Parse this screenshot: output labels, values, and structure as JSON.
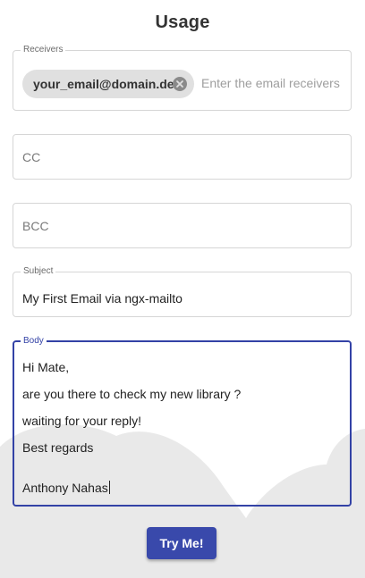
{
  "page_title": "Usage",
  "receivers": {
    "legend": "Receivers",
    "chips": [
      "your_email@domain.de"
    ],
    "input_placeholder": "Enter the email receivers",
    "remove_icon": "cancel-circle-icon"
  },
  "cc": {
    "placeholder": "CC"
  },
  "bcc": {
    "placeholder": "BCC"
  },
  "subject": {
    "legend": "Subject",
    "value": "My First Email via ngx-mailto"
  },
  "body": {
    "legend": "Body",
    "lines": [
      "Hi Mate,",
      "are you there to check my new library ?",
      "waiting for your reply!",
      "Best regards",
      "",
      "Anthony Nahas"
    ]
  },
  "submit_button": {
    "label": "Try Me!"
  },
  "colors": {
    "accent": "#3949ab",
    "focus_border": "#3342a6",
    "chip_bg": "#e0e0e0",
    "cloud_bg": "#e9e9e9"
  }
}
